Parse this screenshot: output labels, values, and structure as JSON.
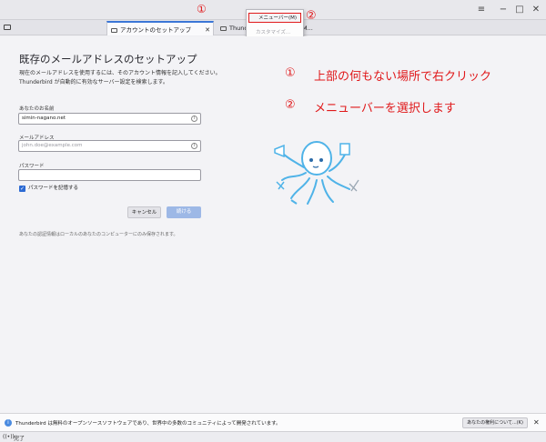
{
  "markers": {
    "one": "①",
    "two": "②"
  },
  "titlebar": {
    "menu_icon": "≡",
    "minimize_icon": "−",
    "maximize_icon": "□",
    "close_icon": "✕"
  },
  "tabs": [
    {
      "label": "アカウントのセットアップ",
      "close": "✕"
    },
    {
      "label": "Thunderbird"
    },
    {
      "label": "M..."
    }
  ],
  "context_menu": {
    "menubar": "メニューバー(M)",
    "customize": "カスタマイズ..."
  },
  "setup": {
    "title": "既存のメールアドレスのセットアップ",
    "desc_line1": "現在のメールアドレスを使用するには、そのアカウント情報を記入してください。",
    "desc_line2": "Thunderbird が自動的に有効なサーバー設定を検索します。",
    "name_label": "あなたのお名前",
    "name_value": "simin-nagano.net",
    "email_label": "メールアドレス",
    "email_placeholder": "john.doe@example.com",
    "password_label": "パスワード",
    "password_value": "",
    "remember_label": "パスワードを記憶する",
    "cancel_button": "キャンセル",
    "continue_button": "続ける",
    "privacy_note": "あなたの認証情報はローカルのあなたのコンピューターにのみ保存されます。"
  },
  "instructions": [
    {
      "marker": "①",
      "text": "上部の何もない場所で右クリック"
    },
    {
      "marker": "②",
      "text": "メニューバーを選択します"
    }
  ],
  "notification": {
    "text": "Thunderbird は無料のオープンソースソフトウェアであり、世界中の多数のコミュニティによって開発されています。",
    "button": "あなたの権利について...(K)",
    "close": "✕"
  },
  "status": {
    "icon": "((•))",
    "text": "完了"
  },
  "colors": {
    "annotation": "#e0191b",
    "accent": "#2c6ad3",
    "mascot": "#4fb3e8"
  }
}
